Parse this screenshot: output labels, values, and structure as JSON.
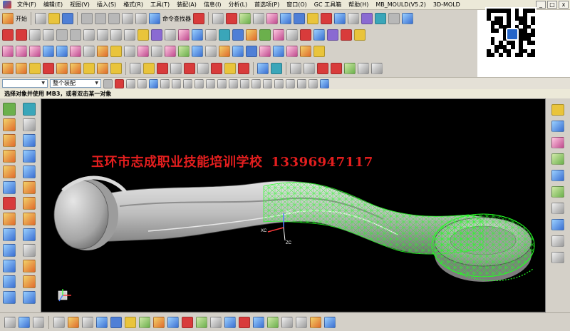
{
  "menu": {
    "items": [
      "文件(F)",
      "编辑(E)",
      "视图(V)",
      "插入(S)",
      "格式(R)",
      "工具(T)",
      "装配(A)",
      "信息(I)",
      "分析(L)",
      "首选项(P)",
      "窗口(O)",
      "GC 工具箱",
      "帮助(H)",
      "MB_MOULD(V5.2)",
      "3D-MOLD"
    ],
    "window_buttons": [
      "_",
      "□",
      "x"
    ]
  },
  "toolbar": {
    "start_label": "开始",
    "command_finder_label": "命令查找器"
  },
  "selection_bar": {
    "filter_value": "",
    "scope_value": "整个装配"
  },
  "status": {
    "prompt": "选择对象并使用 MB3，或者双击某一对象"
  },
  "viewport": {
    "banner_school": "玉环市志成职业技能培训学校",
    "banner_phone": "13396947117",
    "csys_labels": {
      "xc": "XC",
      "yc": "YC",
      "zc": "ZC"
    },
    "colors": {
      "background": "#000000",
      "banner": "#e31e1e",
      "model": "#b8b8b8",
      "mesh": "#22ff22"
    }
  },
  "icons": {
    "qr_code": "qr-code"
  }
}
